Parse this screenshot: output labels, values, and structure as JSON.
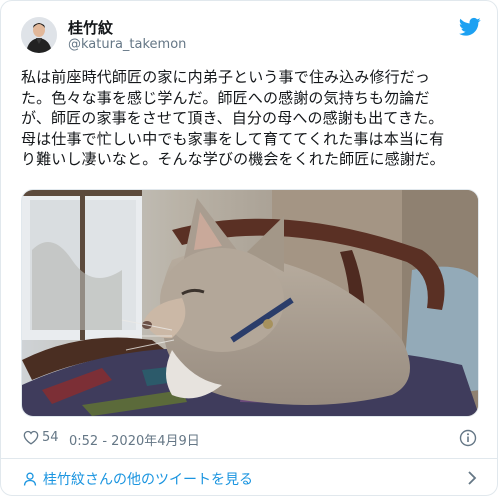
{
  "tweet": {
    "author_name": "桂竹紋",
    "author_handle": "@katura_takemon",
    "text": "私は前座時代師匠の家に内弟子という事で住み込み修行だっ\nた。色々な事を感じ学んだ。師匠への感謝の気持ちも勿論だ\nが、師匠の家事をさせて頂き、自分の母への感謝も出てきた。\n母は仕事で忙しい中でも家事をして育ててくれた事は本当に有\nり難いし凄いなと。そんな学びの機会をくれた師匠に感謝だ。",
    "like_count": "54",
    "timestamp": "0:52 - 2020年4月9日"
  },
  "footer": {
    "link_text": "桂竹紋さんの他のツイートを見る"
  },
  "icons": {
    "logo": "twitter-bird-icon",
    "like": "heart-icon",
    "info": "info-icon",
    "footer_user": "user-icon",
    "chevron": "chevron-right-icon"
  },
  "colors": {
    "brand": "#1da1f2",
    "link": "#1b95e0",
    "secondary_text": "#657786",
    "border": "#e1e8ed"
  }
}
